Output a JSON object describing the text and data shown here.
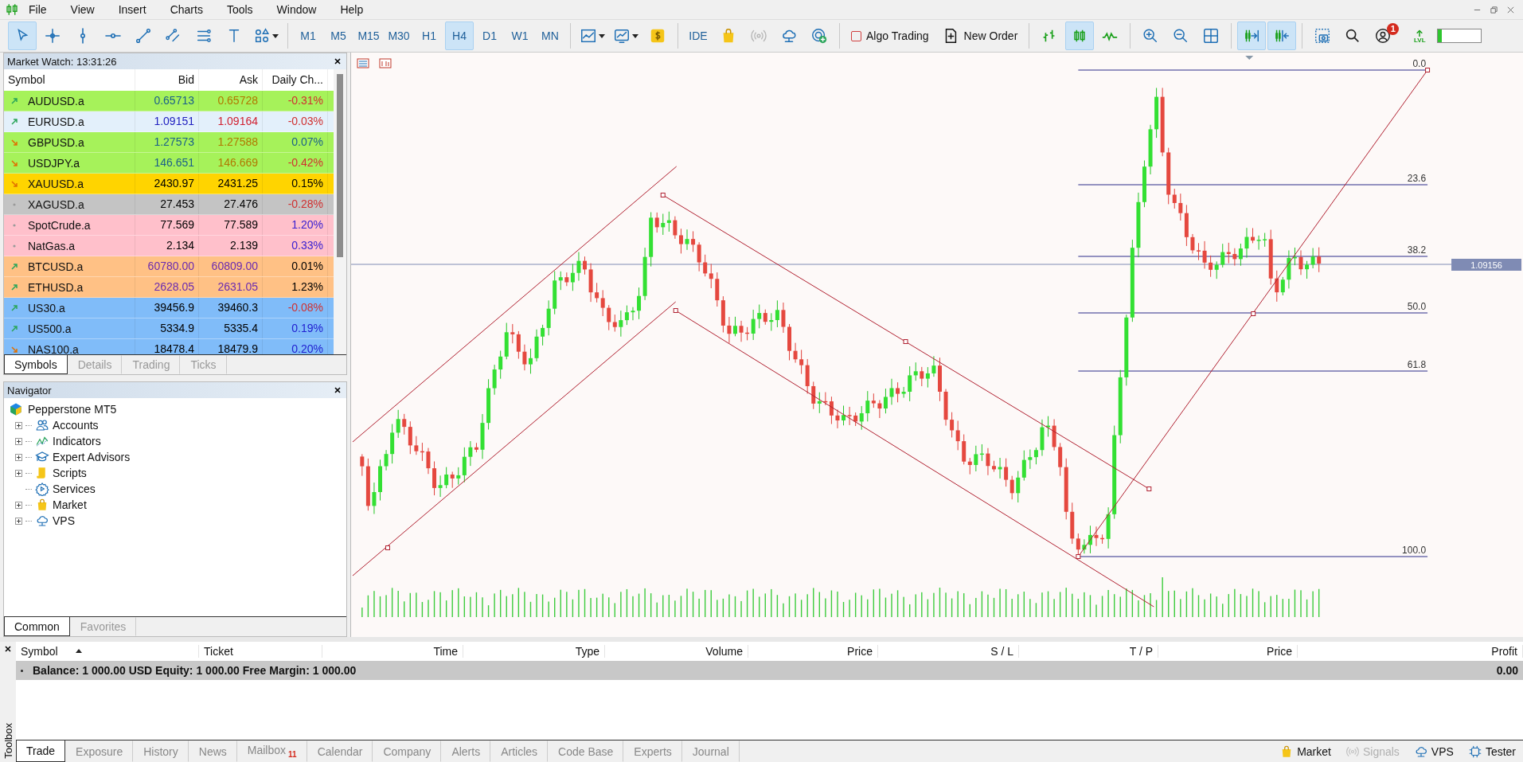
{
  "menu": [
    "File",
    "View",
    "Insert",
    "Charts",
    "Tools",
    "Window",
    "Help"
  ],
  "toolbar": {
    "drawing_tools": [
      {
        "selected": true
      },
      {
        "selected": false
      },
      {
        "selected": false
      },
      {
        "selected": false
      },
      {
        "selected": false
      },
      {
        "selected": false
      },
      {
        "selected": false
      },
      {
        "selected": false
      },
      {
        "selected": false
      }
    ],
    "timeframes": [
      {
        "label": "M1",
        "selected": false
      },
      {
        "label": "M5",
        "selected": false
      },
      {
        "label": "M15",
        "selected": false
      },
      {
        "label": "M30",
        "selected": false
      },
      {
        "label": "H1",
        "selected": false
      },
      {
        "label": "H4",
        "selected": true
      },
      {
        "label": "D1",
        "selected": false
      },
      {
        "label": "W1",
        "selected": false
      },
      {
        "label": "MN",
        "selected": false
      }
    ],
    "ide_label": "IDE",
    "signals": {
      "disabled": true
    },
    "algo_trading": {
      "label": "Algo Trading",
      "on": false
    },
    "new_order": {
      "label": "New Order"
    },
    "chart_types": [
      {
        "selected": false
      },
      {
        "selected": true
      },
      {
        "selected": false
      }
    ],
    "scroll_toggles": [
      {
        "selected": true
      },
      {
        "selected": true
      }
    ],
    "notifications": {
      "count": "1"
    },
    "lvl": {
      "label": "LVL",
      "level": 0.08
    }
  },
  "market_watch": {
    "title": "Market Watch: 13:31:26",
    "columns": [
      "Symbol",
      "Bid",
      "Ask",
      "Daily Ch..."
    ],
    "rows": [
      {
        "kind": "up",
        "symbol": "AUDUSD.a",
        "color": "#a6f25a",
        "bid": {
          "text": "0.65713",
          "color": "#1a5f8a"
        },
        "ask": {
          "text": "0.65728",
          "color": "#b07800"
        },
        "change": {
          "text": "-0.31%",
          "color": "#d03030"
        }
      },
      {
        "kind": "up",
        "symbol": "EURUSD.a",
        "color": "#e3f0fb",
        "bid": {
          "text": "1.09151",
          "color": "#2020c0"
        },
        "ask": {
          "text": "1.09164",
          "color": "#d02030"
        },
        "change": {
          "text": "-0.03%",
          "color": "#d03030"
        }
      },
      {
        "kind": "down",
        "symbol": "GBPUSD.a",
        "color": "#a6f25a",
        "bid": {
          "text": "1.27573",
          "color": "#1a5f8a"
        },
        "ask": {
          "text": "1.27588",
          "color": "#b07800"
        },
        "change": {
          "text": "0.07%",
          "color": "#1a5f8a"
        }
      },
      {
        "kind": "down",
        "symbol": "USDJPY.a",
        "color": "#a6f25a",
        "bid": {
          "text": "146.651",
          "color": "#1a5f8a"
        },
        "ask": {
          "text": "146.669",
          "color": "#b07800"
        },
        "change": {
          "text": "-0.42%",
          "color": "#d03030"
        }
      },
      {
        "kind": "down",
        "symbol": "XAUUSD.a",
        "color": "#ffd400",
        "bid": {
          "text": "2430.97",
          "color": "#000000"
        },
        "ask": {
          "text": "2431.25",
          "color": "#000000"
        },
        "change": {
          "text": "0.15%",
          "color": "#000000"
        }
      },
      {
        "kind": "flat",
        "symbol": "XAGUSD.a",
        "color": "#c4c4c4",
        "bid": {
          "text": "27.453",
          "color": "#000000"
        },
        "ask": {
          "text": "27.476",
          "color": "#000000"
        },
        "change": {
          "text": "-0.28%",
          "color": "#d03030"
        }
      },
      {
        "kind": "flat",
        "symbol": "SpotCrude.a",
        "color": "#ffc0cb",
        "bid": {
          "text": "77.569",
          "color": "#000000"
        },
        "ask": {
          "text": "77.589",
          "color": "#000000"
        },
        "change": {
          "text": "1.20%",
          "color": "#3a20d0"
        }
      },
      {
        "kind": "flat",
        "symbol": "NatGas.a",
        "color": "#ffc0cb",
        "bid": {
          "text": "2.134",
          "color": "#000000"
        },
        "ask": {
          "text": "2.139",
          "color": "#000000"
        },
        "change": {
          "text": "0.33%",
          "color": "#3a20d0"
        }
      },
      {
        "kind": "up",
        "symbol": "BTCUSD.a",
        "color": "#ffc185",
        "bid": {
          "text": "60780.00",
          "color": "#6a2ab0"
        },
        "ask": {
          "text": "60809.00",
          "color": "#6a2ab0"
        },
        "change": {
          "text": "0.01%",
          "color": "#000000"
        }
      },
      {
        "kind": "up",
        "symbol": "ETHUSD.a",
        "color": "#ffc185",
        "bid": {
          "text": "2628.05",
          "color": "#6a2ab0"
        },
        "ask": {
          "text": "2631.05",
          "color": "#6a2ab0"
        },
        "change": {
          "text": "1.23%",
          "color": "#000000"
        }
      },
      {
        "kind": "up",
        "symbol": "US30.a",
        "color": "#80bcf9",
        "bid": {
          "text": "39456.9",
          "color": "#000000"
        },
        "ask": {
          "text": "39460.3",
          "color": "#000000"
        },
        "change": {
          "text": "-0.08%",
          "color": "#d03030"
        }
      },
      {
        "kind": "up",
        "symbol": "US500.a",
        "color": "#80bcf9",
        "bid": {
          "text": "5334.9",
          "color": "#000000"
        },
        "ask": {
          "text": "5335.4",
          "color": "#000000"
        },
        "change": {
          "text": "0.19%",
          "color": "#2020d0"
        }
      },
      {
        "kind": "down",
        "symbol": "NAS100.a",
        "color": "#80bcf9",
        "bid": {
          "text": "18478.4",
          "color": "#000000"
        },
        "ask": {
          "text": "18479.9",
          "color": "#000000"
        },
        "change": {
          "text": "0.20%",
          "color": "#2020d0"
        }
      }
    ],
    "tabs": [
      {
        "label": "Symbols",
        "selected": true
      },
      {
        "label": "Details",
        "selected": false
      },
      {
        "label": "Trading",
        "selected": false
      },
      {
        "label": "Ticks",
        "selected": false
      }
    ]
  },
  "navigator": {
    "title": "Navigator",
    "root": {
      "label": "Pepperstone MT5",
      "children": [
        {
          "label": "Accounts",
          "expandable": true
        },
        {
          "label": "Indicators",
          "expandable": true
        },
        {
          "label": "Expert Advisors",
          "expandable": true
        },
        {
          "label": "Scripts",
          "expandable": true
        },
        {
          "label": "Services",
          "expandable": false
        },
        {
          "label": "Market",
          "expandable": true
        },
        {
          "label": "VPS",
          "expandable": true
        }
      ]
    },
    "tabs": [
      {
        "label": "Common",
        "selected": true
      },
      {
        "label": "Favorites",
        "selected": false
      }
    ]
  },
  "chart": {
    "fib_levels": [
      "0.0",
      "23.6",
      "38.2",
      "50.0",
      "61.8",
      "100.0"
    ],
    "price_label": "1.09156"
  },
  "toolbox": {
    "title": "Toolbox",
    "columns": [
      {
        "label": "Symbol",
        "sorted": true
      },
      {
        "label": "Ticket"
      },
      {
        "label": "Time"
      },
      {
        "label": "Type"
      },
      {
        "label": "Volume"
      },
      {
        "label": "Price"
      },
      {
        "label": "S / L"
      },
      {
        "label": "T / P"
      },
      {
        "label": "Price"
      },
      {
        "label": "Profit"
      }
    ],
    "summary": {
      "text": "Balance: 1 000.00 USD  Equity: 1 000.00  Free Margin: 1 000.00",
      "profit": "0.00"
    },
    "tabs": [
      {
        "label": "Trade",
        "selected": true
      },
      {
        "label": "Exposure",
        "selected": false
      },
      {
        "label": "History",
        "selected": false
      },
      {
        "label": "News",
        "selected": false
      },
      {
        "label": "Mailbox",
        "selected": false,
        "badge": "11"
      },
      {
        "label": "Calendar",
        "selected": false
      },
      {
        "label": "Company",
        "selected": false
      },
      {
        "label": "Alerts",
        "selected": false
      },
      {
        "label": "Articles",
        "selected": false
      },
      {
        "label": "Code Base",
        "selected": false
      },
      {
        "label": "Experts",
        "selected": false
      },
      {
        "label": "Journal",
        "selected": false
      }
    ],
    "status_links": [
      {
        "label": "Market",
        "disabled": false
      },
      {
        "label": "Signals",
        "disabled": true
      },
      {
        "label": "VPS",
        "disabled": false
      },
      {
        "label": "Tester",
        "disabled": false
      }
    ]
  }
}
